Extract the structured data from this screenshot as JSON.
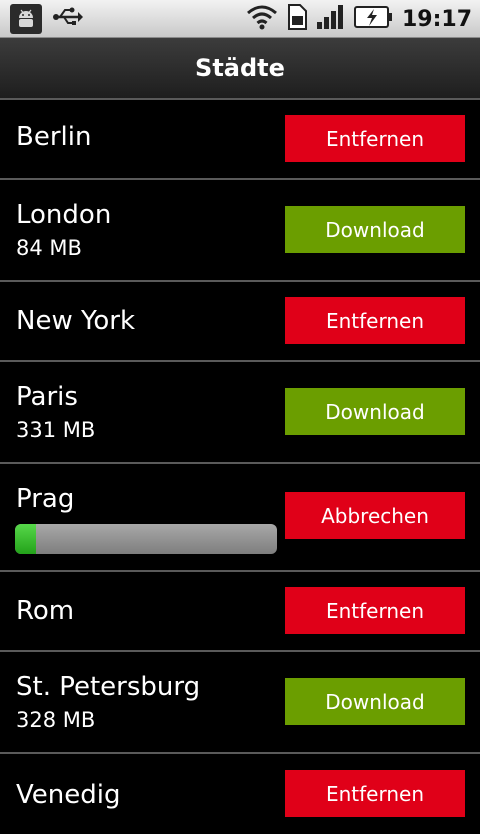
{
  "status_bar": {
    "time": "19:17",
    "icons": [
      "android-debug-icon",
      "usb-icon",
      "wifi-icon",
      "sim-icon",
      "signal-icon",
      "battery-charging-icon"
    ]
  },
  "title": "Städte",
  "colors": {
    "remove_red": "#e00018",
    "download_green": "#6b9e00",
    "progress_green": "#3cc232"
  },
  "cities": [
    {
      "name": "Berlin",
      "size": "",
      "action": "Entfernen"
    },
    {
      "name": "London",
      "size": "84 MB",
      "action": "Download"
    },
    {
      "name": "New York",
      "size": "",
      "action": "Entfernen"
    },
    {
      "name": "Paris",
      "size": "331 MB",
      "action": "Download"
    },
    {
      "name": "Prag",
      "size": "",
      "action": "Abbrechen",
      "progress": 0.08
    },
    {
      "name": "Rom",
      "size": "",
      "action": "Entfernen"
    },
    {
      "name": "St. Petersburg",
      "size": "328 MB",
      "action": "Download"
    },
    {
      "name": "Venedig",
      "size": "",
      "action": "Entfernen"
    }
  ]
}
